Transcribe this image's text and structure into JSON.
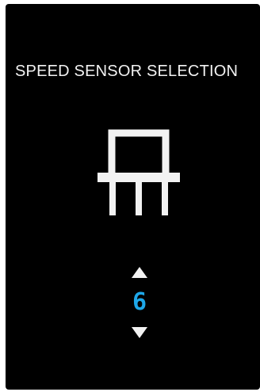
{
  "screen": {
    "title": "SPEED SENSOR SELECTION",
    "sensor_icon": "speed-sensor-icon",
    "selector": {
      "value": "6",
      "increase_icon": "triangle-up-icon",
      "decrease_icon": "triangle-down-icon"
    }
  },
  "colors": {
    "background": "#000000",
    "text": "#f2f2f2",
    "accent": "#1ea7e8"
  }
}
